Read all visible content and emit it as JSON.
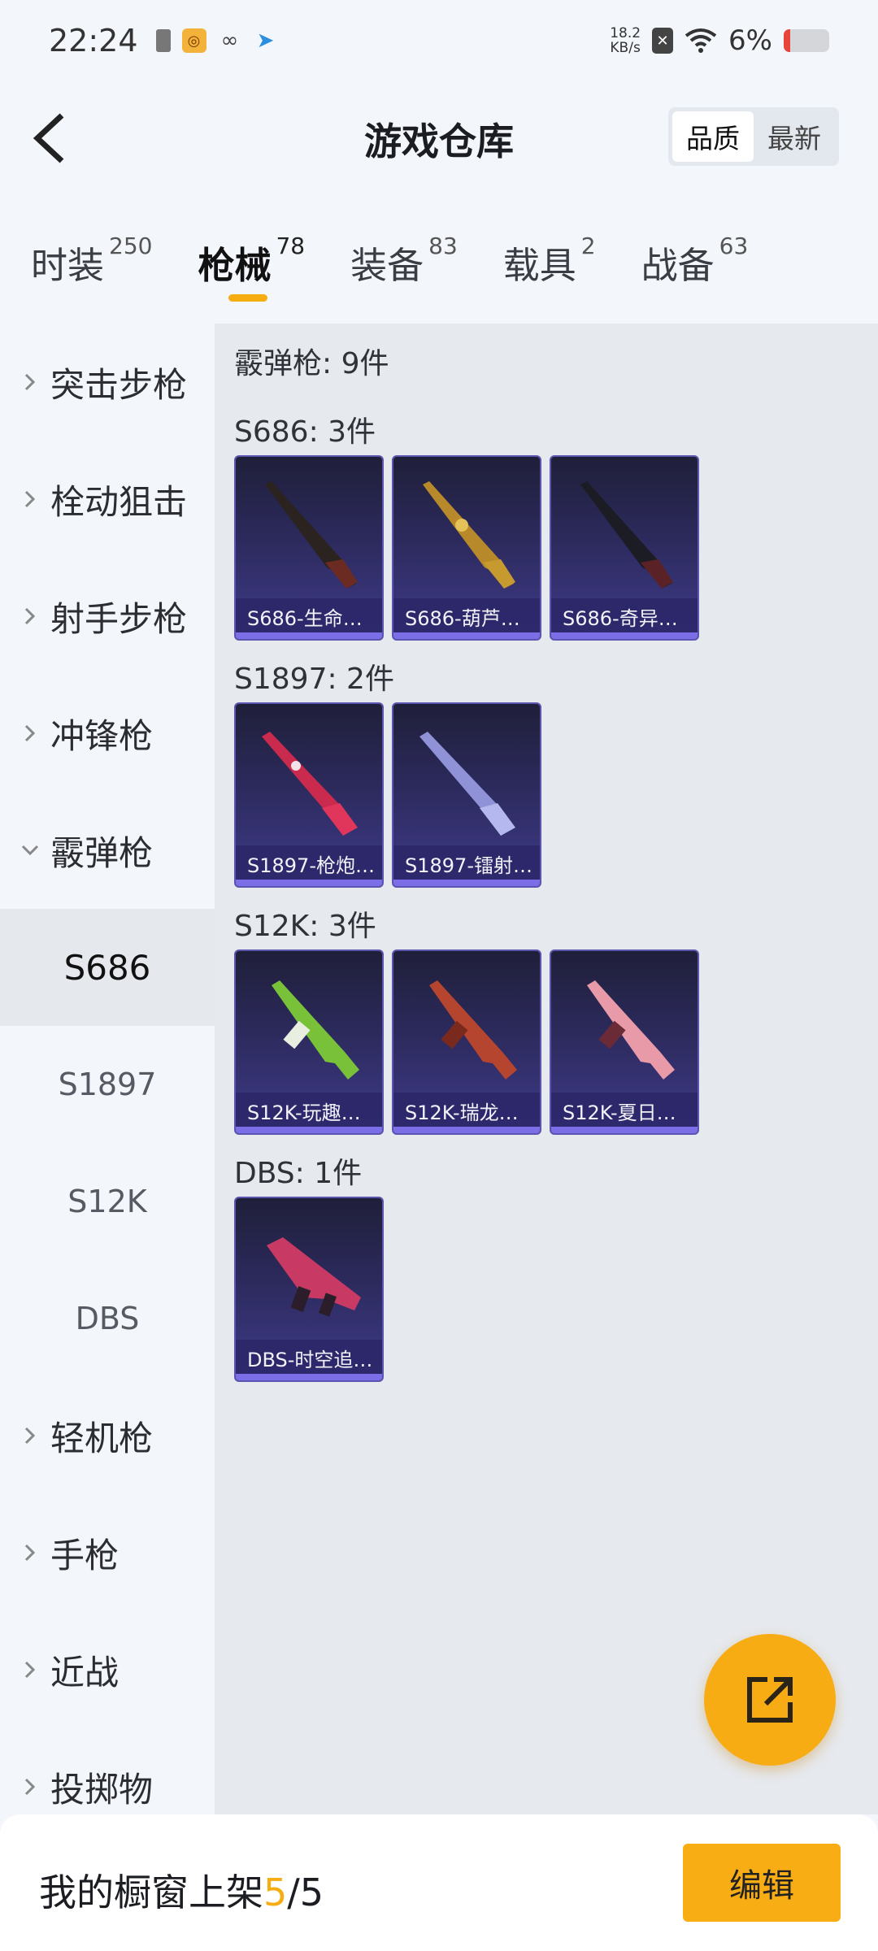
{
  "status_bar": {
    "time": "22:24",
    "net_speed_value": "18.2",
    "net_speed_unit": "KB/s",
    "battery_percent": "6%",
    "battery_level": 0.06,
    "battery_color": "#e9443a"
  },
  "header": {
    "title": "游戏仓库",
    "sort_options": [
      "品质",
      "最新"
    ],
    "sort_selected": "品质"
  },
  "tabs": [
    {
      "label": "时装",
      "count": "250"
    },
    {
      "label": "枪械",
      "count": "78",
      "active": true
    },
    {
      "label": "装备",
      "count": "83"
    },
    {
      "label": "载具",
      "count": "2"
    },
    {
      "label": "战备",
      "count": "63"
    }
  ],
  "sidebar": {
    "items": [
      {
        "label": "突击步枪"
      },
      {
        "label": "栓动狙击"
      },
      {
        "label": "射手步枪"
      },
      {
        "label": "冲锋枪"
      },
      {
        "label": "霰弹枪",
        "expanded": true
      },
      {
        "label": "S686",
        "sub": true,
        "active": true
      },
      {
        "label": "S1897",
        "sub": true
      },
      {
        "label": "S12K",
        "sub": true
      },
      {
        "label": "DBS",
        "sub": true
      },
      {
        "label": "轻机枪"
      },
      {
        "label": "手枪"
      },
      {
        "label": "近战"
      },
      {
        "label": "投掷物"
      }
    ]
  },
  "content": {
    "category_title": "霰弹枪: 9件",
    "groups": [
      {
        "title": "S686: 3件",
        "items": [
          "S686-生命…",
          "S686-葫芦…",
          "S686-奇异…"
        ]
      },
      {
        "title": "S1897: 2件",
        "items": [
          "S1897-枪炮…",
          "S1897-镭射…"
        ]
      },
      {
        "title": "S12K: 3件",
        "items": [
          "S12K-玩趣…",
          "S12K-瑞龙…",
          "S12K-夏日…"
        ]
      },
      {
        "title": "DBS: 1件",
        "items": [
          "DBS-时空追…"
        ]
      }
    ]
  },
  "bottom_bar": {
    "showcase_prefix": "我的橱窗上架",
    "showcase_current": "5",
    "showcase_separator": "/",
    "showcase_total": "5",
    "edit_label": "编辑"
  },
  "colors": {
    "accent": "#f6ad12",
    "card_top": "#1f1f3a",
    "card_bottom": "#3f3a8a"
  }
}
